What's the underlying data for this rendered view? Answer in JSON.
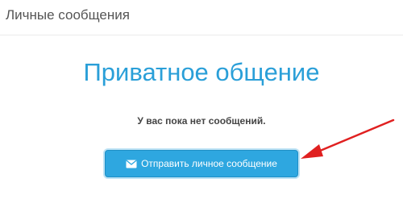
{
  "header": {
    "title": "Личные сообщения"
  },
  "main": {
    "title": "Приватное общение",
    "empty_message": "У вас пока нет сообщений.",
    "send_button_label": "Отправить личное сообщение",
    "send_button_icon": "envelope-icon"
  },
  "colors": {
    "accent": "#2a9fd8",
    "button": "#2ea7e0",
    "annotation_arrow": "#e02020"
  }
}
